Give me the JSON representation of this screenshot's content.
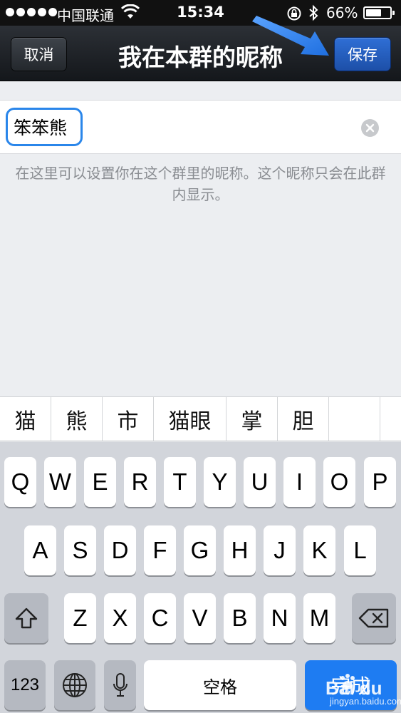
{
  "status_bar": {
    "carrier": "中国联通",
    "time": "15:34",
    "battery_percent": "66%",
    "battery_level": 0.66
  },
  "nav": {
    "cancel_label": "取消",
    "title": "我在本群的昵称",
    "save_label": "保存"
  },
  "form": {
    "nickname_value": "笨笨熊",
    "hint": "在这里可以设置你在这个群里的昵称。这个昵称只会在此群内显示。"
  },
  "candidates": [
    "猫",
    "熊",
    "市",
    "猫眼",
    "掌",
    "胆"
  ],
  "keyboard": {
    "row1": [
      "Q",
      "W",
      "E",
      "R",
      "T",
      "Y",
      "U",
      "I",
      "O",
      "P"
    ],
    "row2": [
      "A",
      "S",
      "D",
      "F",
      "G",
      "H",
      "J",
      "K",
      "L"
    ],
    "row3": [
      "Z",
      "X",
      "C",
      "V",
      "B",
      "N",
      "M"
    ],
    "num_label": "123",
    "space_label": "空格",
    "go_label": "完成"
  },
  "watermark": {
    "brand": "Bai du",
    "url": "jingyan.baidu.com"
  },
  "colors": {
    "accent": "#1e7cf2",
    "focus_border": "#2a86ea",
    "nav_bg": "#14171b"
  }
}
